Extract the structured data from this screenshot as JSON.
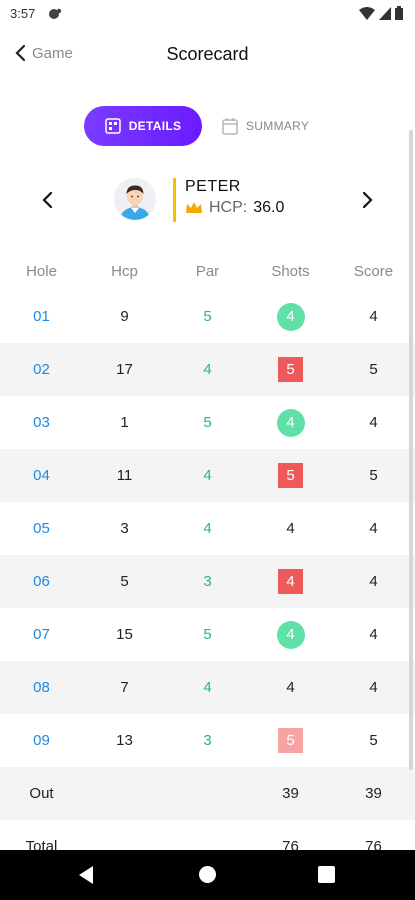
{
  "status": {
    "time": "3:57"
  },
  "header": {
    "back_label": "Game",
    "title": "Scorecard"
  },
  "tabs": {
    "details": "DETAILS",
    "summary": "SUMMARY"
  },
  "player": {
    "name": "PETER",
    "hcp_label": "HCP:",
    "hcp_value": "36.0"
  },
  "table": {
    "headers": [
      "Hole",
      "Hcp",
      "Par",
      "Shots",
      "Score"
    ],
    "rows": [
      {
        "hole": "01",
        "hcp": "9",
        "par": "5",
        "shots": "4",
        "shot_style": "circle",
        "score": "4"
      },
      {
        "hole": "02",
        "hcp": "17",
        "par": "4",
        "shots": "5",
        "shot_style": "square",
        "score": "5"
      },
      {
        "hole": "03",
        "hcp": "1",
        "par": "5",
        "shots": "4",
        "shot_style": "circle",
        "score": "4"
      },
      {
        "hole": "04",
        "hcp": "11",
        "par": "4",
        "shots": "5",
        "shot_style": "square",
        "score": "5"
      },
      {
        "hole": "05",
        "hcp": "3",
        "par": "4",
        "shots": "4",
        "shot_style": "plain",
        "score": "4"
      },
      {
        "hole": "06",
        "hcp": "5",
        "par": "3",
        "shots": "4",
        "shot_style": "square",
        "score": "4"
      },
      {
        "hole": "07",
        "hcp": "15",
        "par": "5",
        "shots": "4",
        "shot_style": "circle",
        "score": "4"
      },
      {
        "hole": "08",
        "hcp": "7",
        "par": "4",
        "shots": "4",
        "shot_style": "plain",
        "score": "4"
      },
      {
        "hole": "09",
        "hcp": "13",
        "par": "3",
        "shots": "5",
        "shot_style": "square-light",
        "score": "5"
      }
    ],
    "out": {
      "label": "Out",
      "shots": "39",
      "score": "39"
    },
    "total": {
      "label": "Total",
      "shots": "76",
      "score": "76"
    }
  },
  "colors": {
    "accent": "#6a1bff",
    "hole_link": "#1e88e5",
    "par_green": "#2bb673",
    "birdie_circle": "#5ee0a6",
    "bogey_square": "#ee5a5a",
    "hcp_bar": "#f2c200"
  },
  "icons": {
    "back": "chevron-left-icon",
    "details": "scorecard-icon",
    "summary": "calendar-icon",
    "crown": "crown-icon",
    "prev": "chevron-left-icon",
    "next": "chevron-right-icon"
  }
}
